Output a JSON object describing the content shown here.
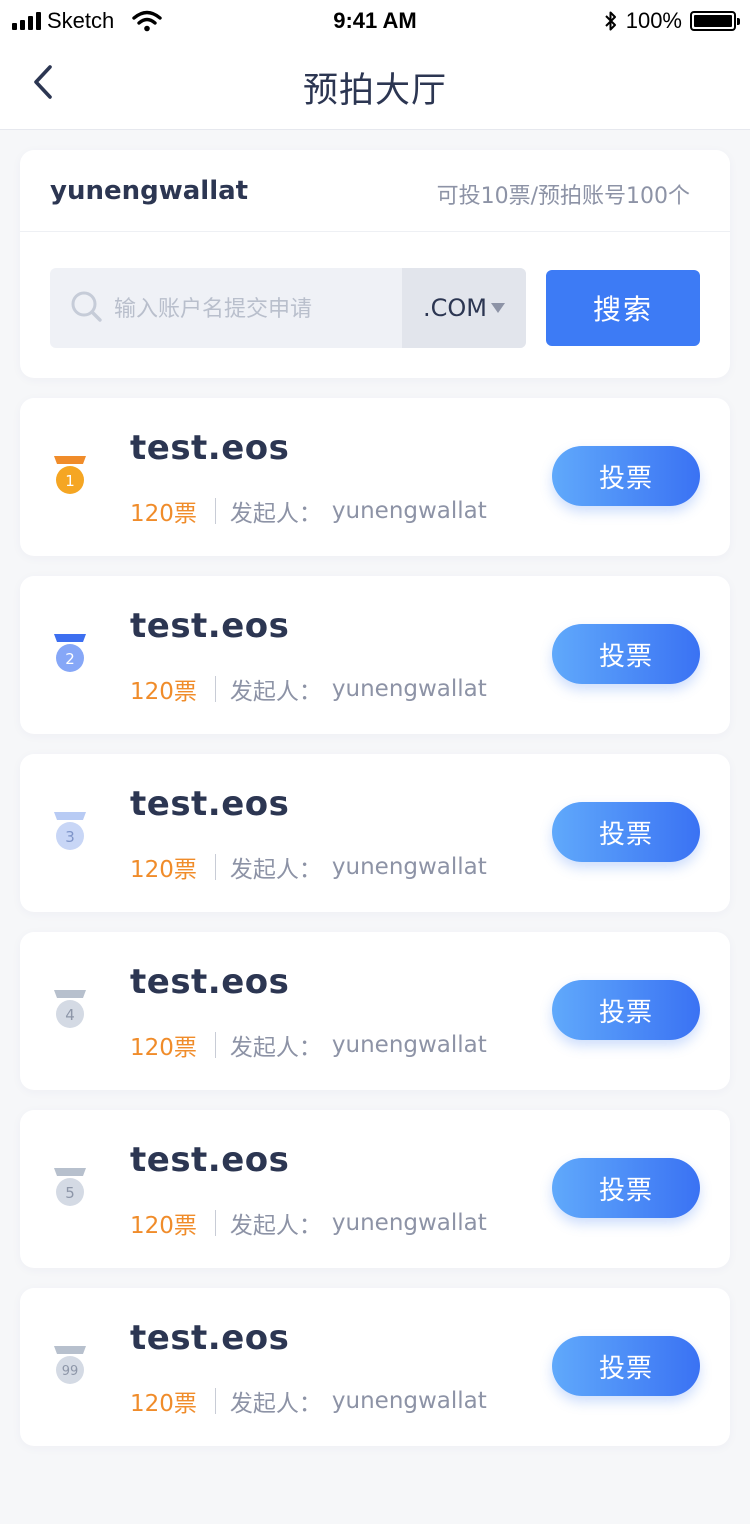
{
  "status_bar": {
    "carrier": "Sketch",
    "time": "9:41 AM",
    "battery": "100%"
  },
  "nav": {
    "title": "预拍大厅"
  },
  "search_panel": {
    "account": "yunengwallat",
    "quota": "可投10票/预拍账号100个",
    "placeholder": "输入账户名提交申请",
    "domain_suffix": ".COM",
    "search_label": "搜索"
  },
  "colors": {
    "accent": "#3d7bf5",
    "votes": "#f08c2a",
    "rank1": "#f5a623",
    "rank1_ribbon": "#f08c2a",
    "rank2": "#86a7f7",
    "rank2_ribbon": "#3d6ff0",
    "rank3": "#c8d6f6",
    "rank3_ribbon": "#b8cbf4",
    "rank_other": "#d4dae4",
    "rank_other_ribbon": "#b7c0cd"
  },
  "list": [
    {
      "rank": "1",
      "name": "test.eos",
      "votes": "120票",
      "initiator_label": "发起人：",
      "initiator": "yunengwallat",
      "vote_label": "投票"
    },
    {
      "rank": "2",
      "name": "test.eos",
      "votes": "120票",
      "initiator_label": "发起人：",
      "initiator": "yunengwallat",
      "vote_label": "投票"
    },
    {
      "rank": "3",
      "name": "test.eos",
      "votes": "120票",
      "initiator_label": "发起人：",
      "initiator": "yunengwallat",
      "vote_label": "投票"
    },
    {
      "rank": "4",
      "name": "test.eos",
      "votes": "120票",
      "initiator_label": "发起人：",
      "initiator": "yunengwallat",
      "vote_label": "投票"
    },
    {
      "rank": "5",
      "name": "test.eos",
      "votes": "120票",
      "initiator_label": "发起人：",
      "initiator": "yunengwallat",
      "vote_label": "投票"
    },
    {
      "rank": "99",
      "name": "test.eos",
      "votes": "120票",
      "initiator_label": "发起人：",
      "initiator": "yunengwallat",
      "vote_label": "投票"
    }
  ]
}
